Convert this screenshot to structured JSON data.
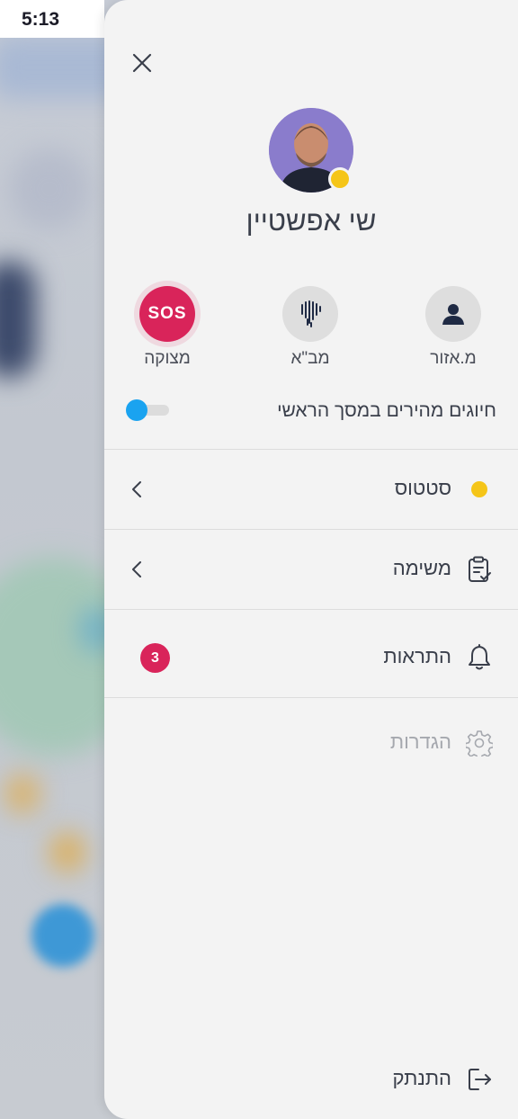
{
  "status_bar": {
    "time": "5:13"
  },
  "profile": {
    "name": "שי אפשטיין",
    "presence_color": "#f5c518"
  },
  "quick_actions": [
    {
      "label": "מ.אזור",
      "icon": "person-icon"
    },
    {
      "label": "מב\"א",
      "icon": "fingerprint-icon"
    },
    {
      "label": "מצוקה",
      "icon": "sos-icon",
      "icon_text": "SOS",
      "color": "#d9245a"
    }
  ],
  "quick_dial_toggle": {
    "label": "חיוגים מהירים במסך הראשי",
    "enabled": false,
    "accent": "#1aa3f0"
  },
  "menu": {
    "status": {
      "label": "סטטוס",
      "dot_color": "#f5c518"
    },
    "task": {
      "label": "משימה"
    },
    "notifications": {
      "label": "התראות",
      "badge": "3"
    },
    "settings": {
      "label": "הגדרות",
      "disabled": true
    },
    "logout": {
      "label": "התנתק"
    }
  },
  "colors": {
    "accent_red": "#d9245a",
    "panel_bg": "#f3f3f3",
    "text": "#3a3f4b"
  }
}
